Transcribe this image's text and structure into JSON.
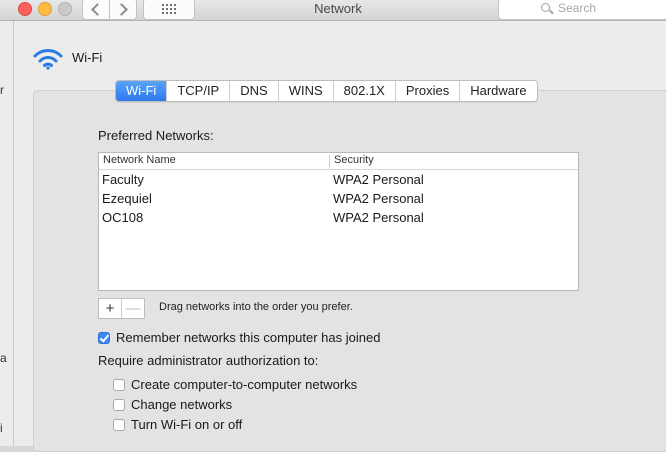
{
  "window": {
    "title": "Network",
    "search_placeholder": "Search"
  },
  "left_fragments": [
    "r",
    "a",
    "i"
  ],
  "header": {
    "title": "Wi-Fi"
  },
  "tabs": [
    {
      "label": "Wi-Fi",
      "active": true
    },
    {
      "label": "TCP/IP"
    },
    {
      "label": "DNS"
    },
    {
      "label": "WINS"
    },
    {
      "label": "802.1X"
    },
    {
      "label": "Proxies"
    },
    {
      "label": "Hardware"
    }
  ],
  "preferred": {
    "label": "Preferred Networks:",
    "columns": [
      "Network Name",
      "Security"
    ],
    "rows": [
      {
        "name": "Faculty",
        "security": "WPA2 Personal"
      },
      {
        "name": "Ezequiel",
        "security": "WPA2 Personal"
      },
      {
        "name": "OC108",
        "security": "WPA2 Personal"
      }
    ],
    "add_label": "+",
    "remove_label": "—",
    "drag_hint": "Drag networks into the order you prefer."
  },
  "remember": {
    "label": "Remember networks this computer has joined",
    "checked": true
  },
  "admin": {
    "label": "Require administrator authorization to:",
    "options": [
      {
        "label": "Create computer-to-computer networks",
        "checked": false
      },
      {
        "label": "Change networks",
        "checked": false
      },
      {
        "label": "Turn Wi-Fi on or off",
        "checked": false
      }
    ]
  },
  "colors": {
    "accent": "#2b7af0",
    "wifi_icon": "#2a7be4"
  }
}
